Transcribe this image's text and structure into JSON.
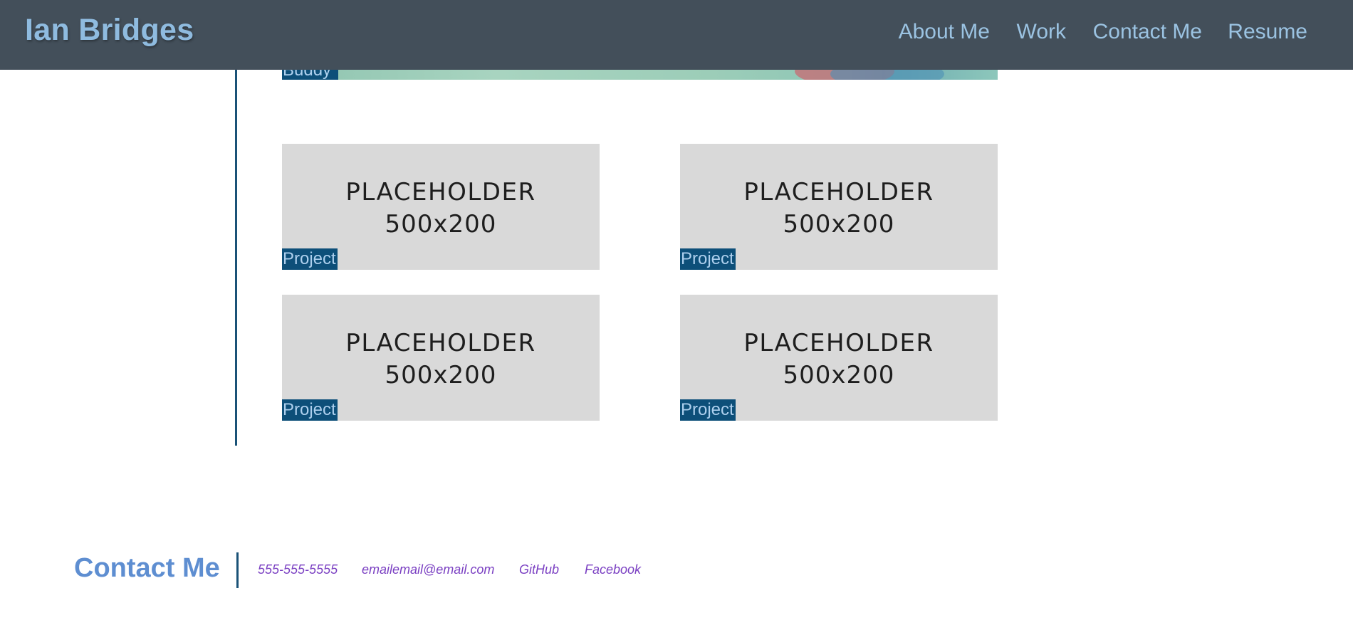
{
  "header": {
    "title": "Ian Bridges",
    "nav": [
      {
        "label": "About Me"
      },
      {
        "label": "Work"
      },
      {
        "label": "Contact Me"
      },
      {
        "label": "Resume"
      }
    ]
  },
  "work": {
    "featured_label": "Buddy",
    "projects": [
      {
        "placeholder_line1": "PLACEHOLDER",
        "placeholder_line2": "500x200",
        "label": "Project"
      },
      {
        "placeholder_line1": "PLACEHOLDER",
        "placeholder_line2": "500x200",
        "label": "Project"
      },
      {
        "placeholder_line1": "PLACEHOLDER",
        "placeholder_line2": "500x200",
        "label": "Project"
      },
      {
        "placeholder_line1": "PLACEHOLDER",
        "placeholder_line2": "500x200",
        "label": "Project"
      }
    ]
  },
  "contact": {
    "title": "Contact Me",
    "phone": "555-555-5555",
    "email": "emailemail@email.com",
    "github": "GitHub",
    "facebook": "Facebook"
  },
  "colors": {
    "header_bg": "#434f5a",
    "accent_blue": "#0d4f79",
    "title_blue": "#8fbbdf",
    "contact_title": "#5e8ed1",
    "link_purple": "#7a3fc2",
    "placeholder_gray": "#d9d9d9"
  }
}
